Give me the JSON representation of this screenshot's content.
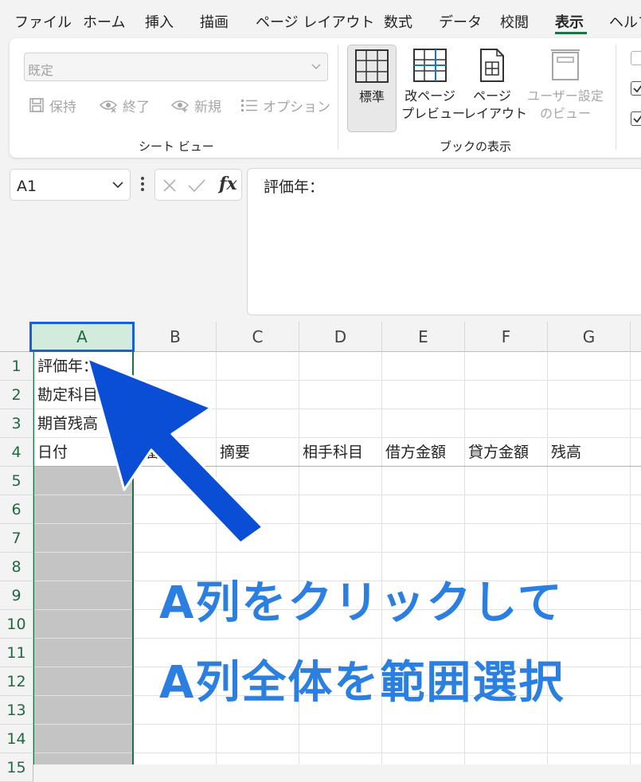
{
  "ribbon_tabs": [
    "ファイル",
    "ホーム",
    "挿入",
    "描画",
    "ページ レイアウト",
    "数式",
    "データ",
    "校閲",
    "表示",
    "ヘルプ"
  ],
  "active_tab": "表示",
  "sheet_view": {
    "select_value": "既定",
    "buttons": {
      "keep": "保持",
      "exit": "終了",
      "new": "新規",
      "options": "オプション"
    },
    "group_label": "シート ビュー"
  },
  "workbook_views": {
    "normal": "標準",
    "page_break_1": "改ページ",
    "page_break_2": "プレビュー",
    "page_layout_1": "ページ",
    "page_layout_2": "レイアウト",
    "custom_1": "ユーザー設定",
    "custom_2": "のビュー",
    "group_label": "ブックの表示"
  },
  "name_box": "A1",
  "formula_bar": {
    "fx": "fx",
    "content": "評価年："
  },
  "columns": [
    "A",
    "B",
    "C",
    "D",
    "E",
    "F",
    "G"
  ],
  "rows": [
    "1",
    "2",
    "3",
    "4",
    "5",
    "6",
    "7",
    "8",
    "9",
    "10",
    "11",
    "12",
    "13",
    "14",
    "15"
  ],
  "cells": {
    "a1": "評価年：",
    "a2": "勘定科目",
    "a3": "期首残高",
    "a4": "日付",
    "b4": "番号",
    "c4": "摘要",
    "d4": "相手科目",
    "e4": "借方金額",
    "f4": "貸方金額",
    "g4": "残高"
  },
  "annotation": {
    "line1": "A列をクリックして",
    "line2": "A列全体を範囲選択",
    "color": "#2b7fe0",
    "arrow_color": "#0b4ed6"
  }
}
